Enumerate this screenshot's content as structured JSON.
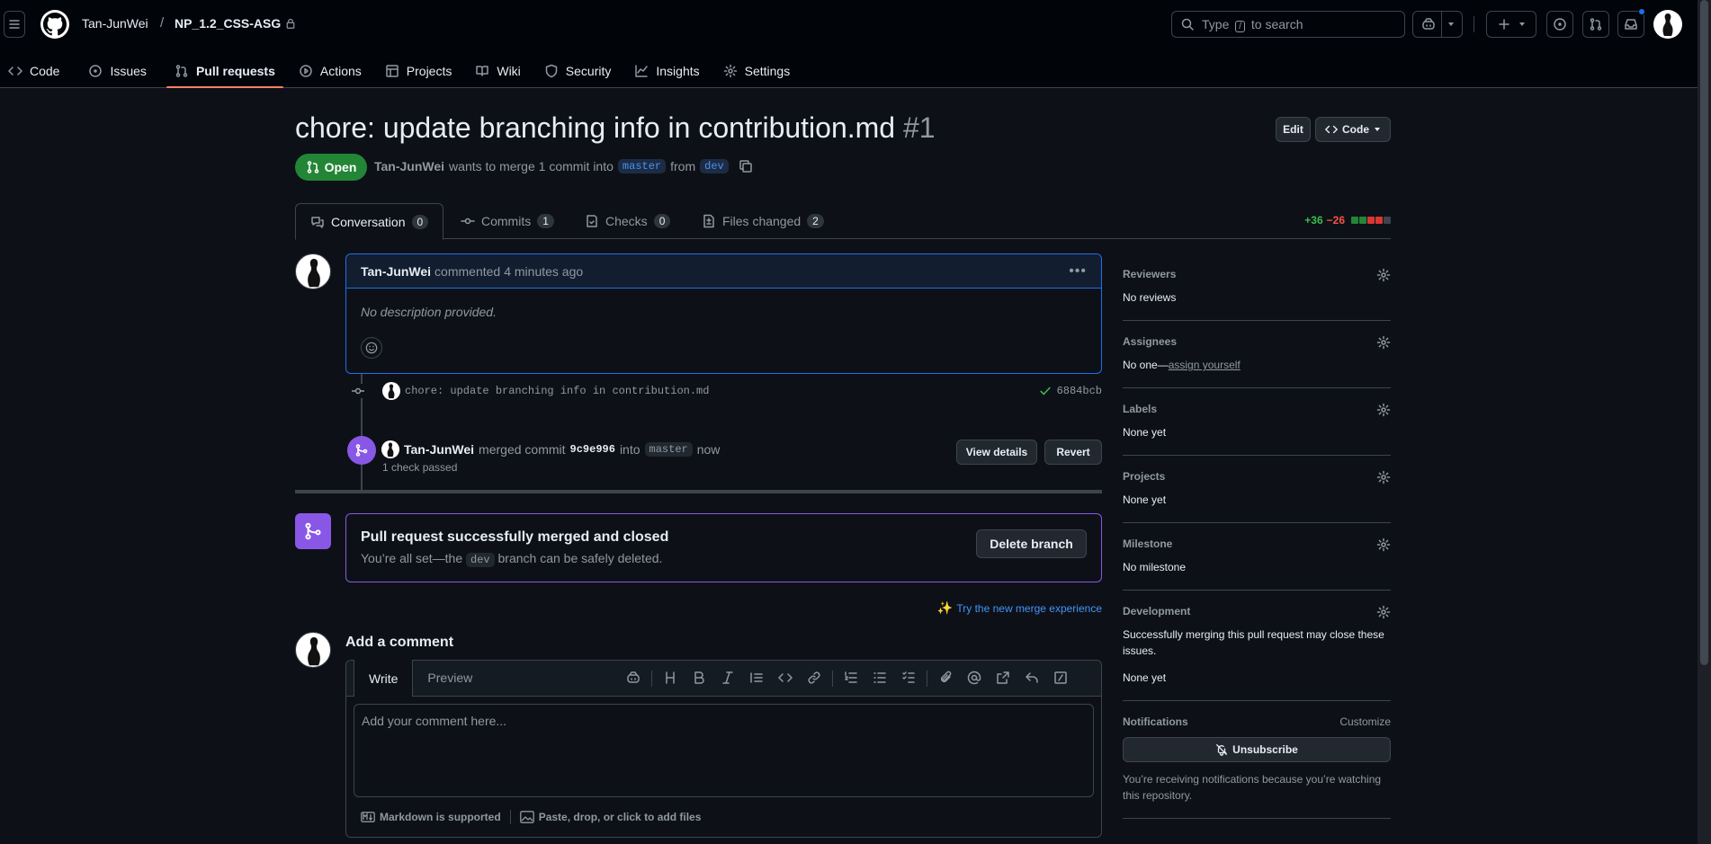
{
  "header": {
    "owner": "Tan-JunWei",
    "repo": "NP_1.2_CSS-ASG",
    "search_pre": "Type",
    "search_key": "/",
    "search_post": "to search"
  },
  "repo_tabs": [
    "Code",
    "Issues",
    "Pull requests",
    "Actions",
    "Projects",
    "Wiki",
    "Security",
    "Insights",
    "Settings"
  ],
  "pr": {
    "title": "chore: update branching info in contribution.md",
    "number": "#1",
    "edit_label": "Edit",
    "code_label": "Code",
    "state": "Open",
    "author": "Tan-JunWei",
    "meta_mid": "wants to merge 1 commit into",
    "base": "master",
    "meta_from": "from",
    "head": "dev"
  },
  "pr_tabs": [
    {
      "label": "Conversation",
      "count": "0"
    },
    {
      "label": "Commits",
      "count": "1"
    },
    {
      "label": "Checks",
      "count": "0"
    },
    {
      "label": "Files changed",
      "count": "2"
    }
  ],
  "diffstat": {
    "add": "+36",
    "del": "−26"
  },
  "comment": {
    "author": "Tan-JunWei",
    "action": "commented",
    "time": "4 minutes ago",
    "body": "No description provided."
  },
  "commit": {
    "message": "chore: update branching info in contribution.md",
    "sha": "6884bcb"
  },
  "merge_event": {
    "author": "Tan-JunWei",
    "action": "merged commit",
    "sha": "9c9e996",
    "into": "into",
    "branch": "master",
    "time": "now",
    "checks": "1 check passed",
    "view_details": "View details",
    "revert": "Revert"
  },
  "merged_box": {
    "title": "Pull request successfully merged and closed",
    "text_pre": "You’re all set—the",
    "branch": "dev",
    "text_post": "branch can be safely deleted.",
    "delete_button": "Delete branch"
  },
  "try_link": "Try the new merge experience",
  "add_comment": {
    "heading": "Add a comment",
    "write_tab": "Write",
    "preview_tab": "Preview",
    "placeholder": "Add your comment here...",
    "markdown": "Markdown is supported",
    "attach": "Paste, drop, or click to add files"
  },
  "sidebar": {
    "reviewers": {
      "label": "Reviewers",
      "value": "No reviews"
    },
    "assignees": {
      "label": "Assignees",
      "value_pre": "No one—",
      "value_link": "assign yourself"
    },
    "labels": {
      "label": "Labels",
      "value": "None yet"
    },
    "projects": {
      "label": "Projects",
      "value": "None yet"
    },
    "milestone": {
      "label": "Milestone",
      "value": "No milestone"
    },
    "development": {
      "label": "Development",
      "text": "Successfully merging this pull request may close these issues.",
      "value": "None yet"
    },
    "notifications": {
      "label": "Notifications",
      "customize": "Customize",
      "button": "Unsubscribe",
      "text": "You’re receiving notifications because you’re watching this repository."
    }
  }
}
